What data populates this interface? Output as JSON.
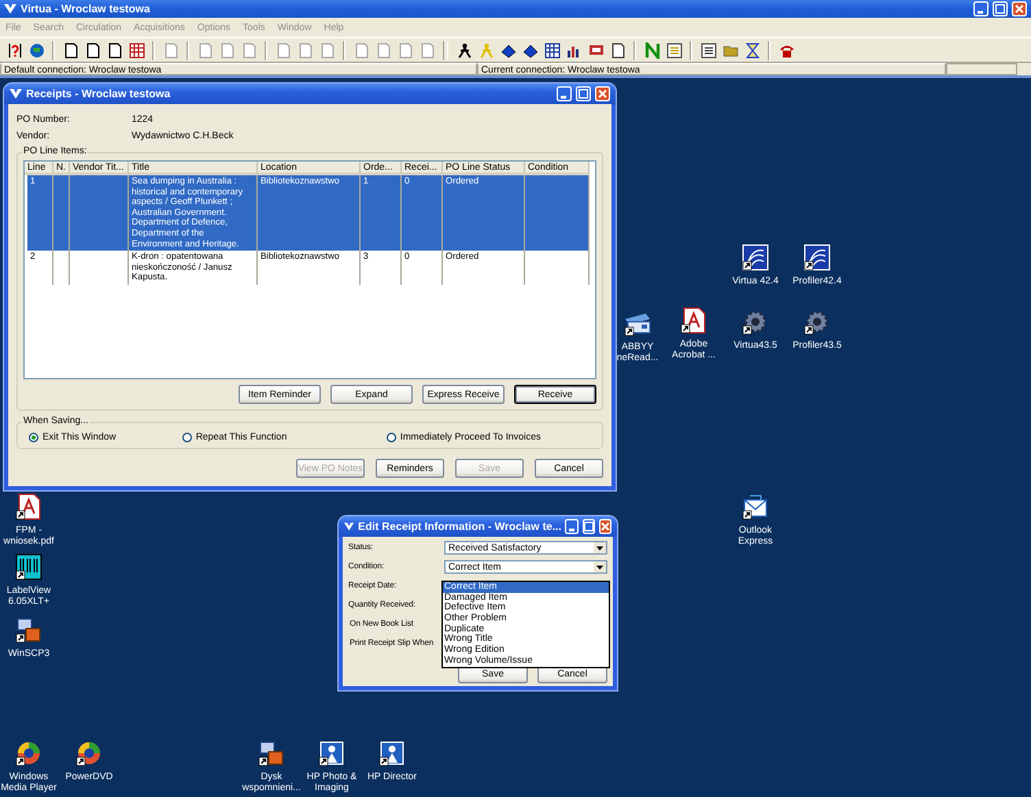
{
  "app": {
    "title": "Virtua - Wroclaw testowa",
    "menu": [
      "File",
      "Search",
      "Circulation",
      "Acquisitions",
      "Options",
      "Tools",
      "Window",
      "Help"
    ],
    "status_left": "Default connection: Wroclaw testowa",
    "status_right": "Current connection: Wroclaw testowa"
  },
  "desktop_icons": [
    {
      "lines": [
        "Virtua 42.4"
      ]
    },
    {
      "lines": [
        "Profiler42.4"
      ]
    },
    {
      "lines": [
        "ABBYY",
        "neRead..."
      ]
    },
    {
      "lines": [
        "Adobe",
        "Acrobat ..."
      ]
    },
    {
      "lines": [
        "Virtua43.5"
      ]
    },
    {
      "lines": [
        "Profiler43.5"
      ]
    },
    {
      "lines": [
        "FPM -",
        "wniosek.pdf"
      ]
    },
    {
      "lines": [
        "Outlook",
        "Express"
      ]
    },
    {
      "lines": [
        "LabelView",
        "6.05XLT+"
      ]
    },
    {
      "lines": [
        "WinSCP3"
      ]
    },
    {
      "lines": [
        "Windows",
        "Media Player"
      ]
    },
    {
      "lines": [
        "PowerDVD"
      ]
    },
    {
      "lines": [
        "Dysk",
        "wspomnieni..."
      ]
    },
    {
      "lines": [
        "HP Photo &",
        "Imaging"
      ]
    },
    {
      "lines": [
        "HP Director"
      ]
    }
  ],
  "receipts_window": {
    "title": "Receipts - Wroclaw testowa",
    "fields": [
      {
        "label": "PO Number:",
        "value": "1224"
      },
      {
        "label": "Vendor:",
        "value": "Wydawnictwo C.H.Beck"
      }
    ],
    "group_title": "PO Line Items:",
    "columns": [
      "Line",
      "N.",
      "Vendor Tit...",
      "Title",
      "Location",
      "Orde...",
      "Recei...",
      "PO Line Status",
      "Condition"
    ],
    "rows": [
      {
        "selected": true,
        "cells": [
          "1",
          "",
          "",
          "Sea dumping in Australia : historical and contemporary aspects / Geoff Plunkett ; Australian Government. Department of Defence, Department of the Environment and Heritage.",
          "Bibliotekoznawstwo",
          "1",
          "0",
          "Ordered",
          ""
        ]
      },
      {
        "selected": false,
        "cells": [
          "2",
          "",
          "",
          "K-dron : opatentowana nieskończoność / Janusz Kapusta.",
          "Bibliotekoznawstwo",
          "3",
          "0",
          "Ordered",
          ""
        ]
      }
    ],
    "buttons": [
      {
        "label": "Item Reminder",
        "default": false
      },
      {
        "label": "Expand",
        "default": false
      },
      {
        "label": "Express Receive",
        "default": false
      },
      {
        "label": "Receive",
        "default": true
      }
    ],
    "saving": {
      "title": "When Saving...",
      "options": [
        {
          "label": "Exit This Window",
          "selected": true
        },
        {
          "label": "Repeat This Function",
          "selected": false
        },
        {
          "label": "Immediately Proceed To Invoices",
          "selected": false
        }
      ]
    },
    "footer_buttons": [
      {
        "label": "View PO Notes",
        "disabled": true
      },
      {
        "label": "Reminders",
        "disabled": false
      },
      {
        "label": "Save",
        "disabled": true
      },
      {
        "label": "Cancel",
        "disabled": false
      }
    ]
  },
  "edit_window": {
    "title": "Edit Receipt Information - Wroclaw te...",
    "labels": [
      "Status:",
      "Condition:",
      "Receipt Date:",
      "Quantity Received:",
      "On New Book List",
      "Print Receipt Slip When"
    ],
    "status_value": "Received Satisfactory",
    "condition_value": "Correct Item",
    "options": [
      {
        "label": "Correct Item",
        "selected": true
      },
      {
        "label": "Damaged Item",
        "selected": false
      },
      {
        "label": "Defective Item",
        "selected": false
      },
      {
        "label": "Other Problem",
        "selected": false
      },
      {
        "label": "Duplicate",
        "selected": false
      },
      {
        "label": "Wrong Title",
        "selected": false
      },
      {
        "label": "Wrong Edition",
        "selected": false
      },
      {
        "label": "Wrong Volume/Issue",
        "selected": false
      }
    ],
    "buttons": [
      "Save",
      "Cancel"
    ]
  }
}
